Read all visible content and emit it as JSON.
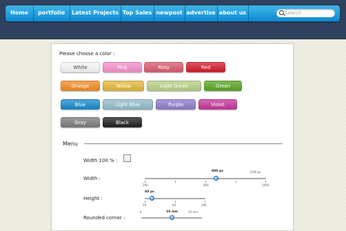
{
  "nav": {
    "items": [
      "Home",
      "portfolio",
      "Latest Projects",
      "Top Sales",
      "newpost",
      "advertise",
      "about us"
    ]
  },
  "search": {
    "placeholder": "Search"
  },
  "colors_section": {
    "prompt": "Please choose a color :",
    "buttons": [
      {
        "label": "White",
        "color": "#f4f4f4",
        "text": "#444"
      },
      {
        "label": "Pink",
        "color": "#f28ec8",
        "text": "#fff"
      },
      {
        "label": "Rosy",
        "color": "#d95a6e",
        "text": "#fff"
      },
      {
        "label": "Red",
        "color": "#cf1b2b",
        "text": "#fff"
      },
      {
        "label": "Orange",
        "color": "#ef8a22",
        "text": "#fff"
      },
      {
        "label": "Yellow",
        "color": "#e0b73a",
        "text": "#fff"
      },
      {
        "label": "Light Green",
        "color": "#b5cf86",
        "text": "#fff"
      },
      {
        "label": "Green",
        "color": "#5aa322",
        "text": "#fff"
      },
      {
        "label": "Blue",
        "color": "#1689c9",
        "text": "#fff"
      },
      {
        "label": "Light Blue",
        "color": "#8fb9c8",
        "text": "#fff"
      },
      {
        "label": "Purple",
        "color": "#8c7ac8",
        "text": "#fff"
      },
      {
        "label": "Violet",
        "color": "#c23497",
        "text": "#fff"
      },
      {
        "label": "Gray",
        "color": "#7a7a7a",
        "text": "#fff"
      },
      {
        "label": "Black",
        "color": "#1f1f1f",
        "text": "#fff"
      }
    ]
  },
  "menu": {
    "title": "Menu",
    "width100_label": "Width 100 % :",
    "width_label": "Width :",
    "width_slider": {
      "value_text": "800 px",
      "max_text": "1200 px",
      "ticks": [
        "200",
        "400",
        "1000"
      ],
      "value_fraction": 0.59
    },
    "height_label": "Height :",
    "height_slider": {
      "value_text": "40 px",
      "ticks": [
        "20",
        "40",
        "200"
      ],
      "value_fraction": 0.12
    },
    "corner_label": "Rounded corner :",
    "corner_slider": {
      "value_text": "10 mm",
      "ticks": [
        "0",
        "20 mm"
      ],
      "value_fraction": 0.5
    }
  }
}
